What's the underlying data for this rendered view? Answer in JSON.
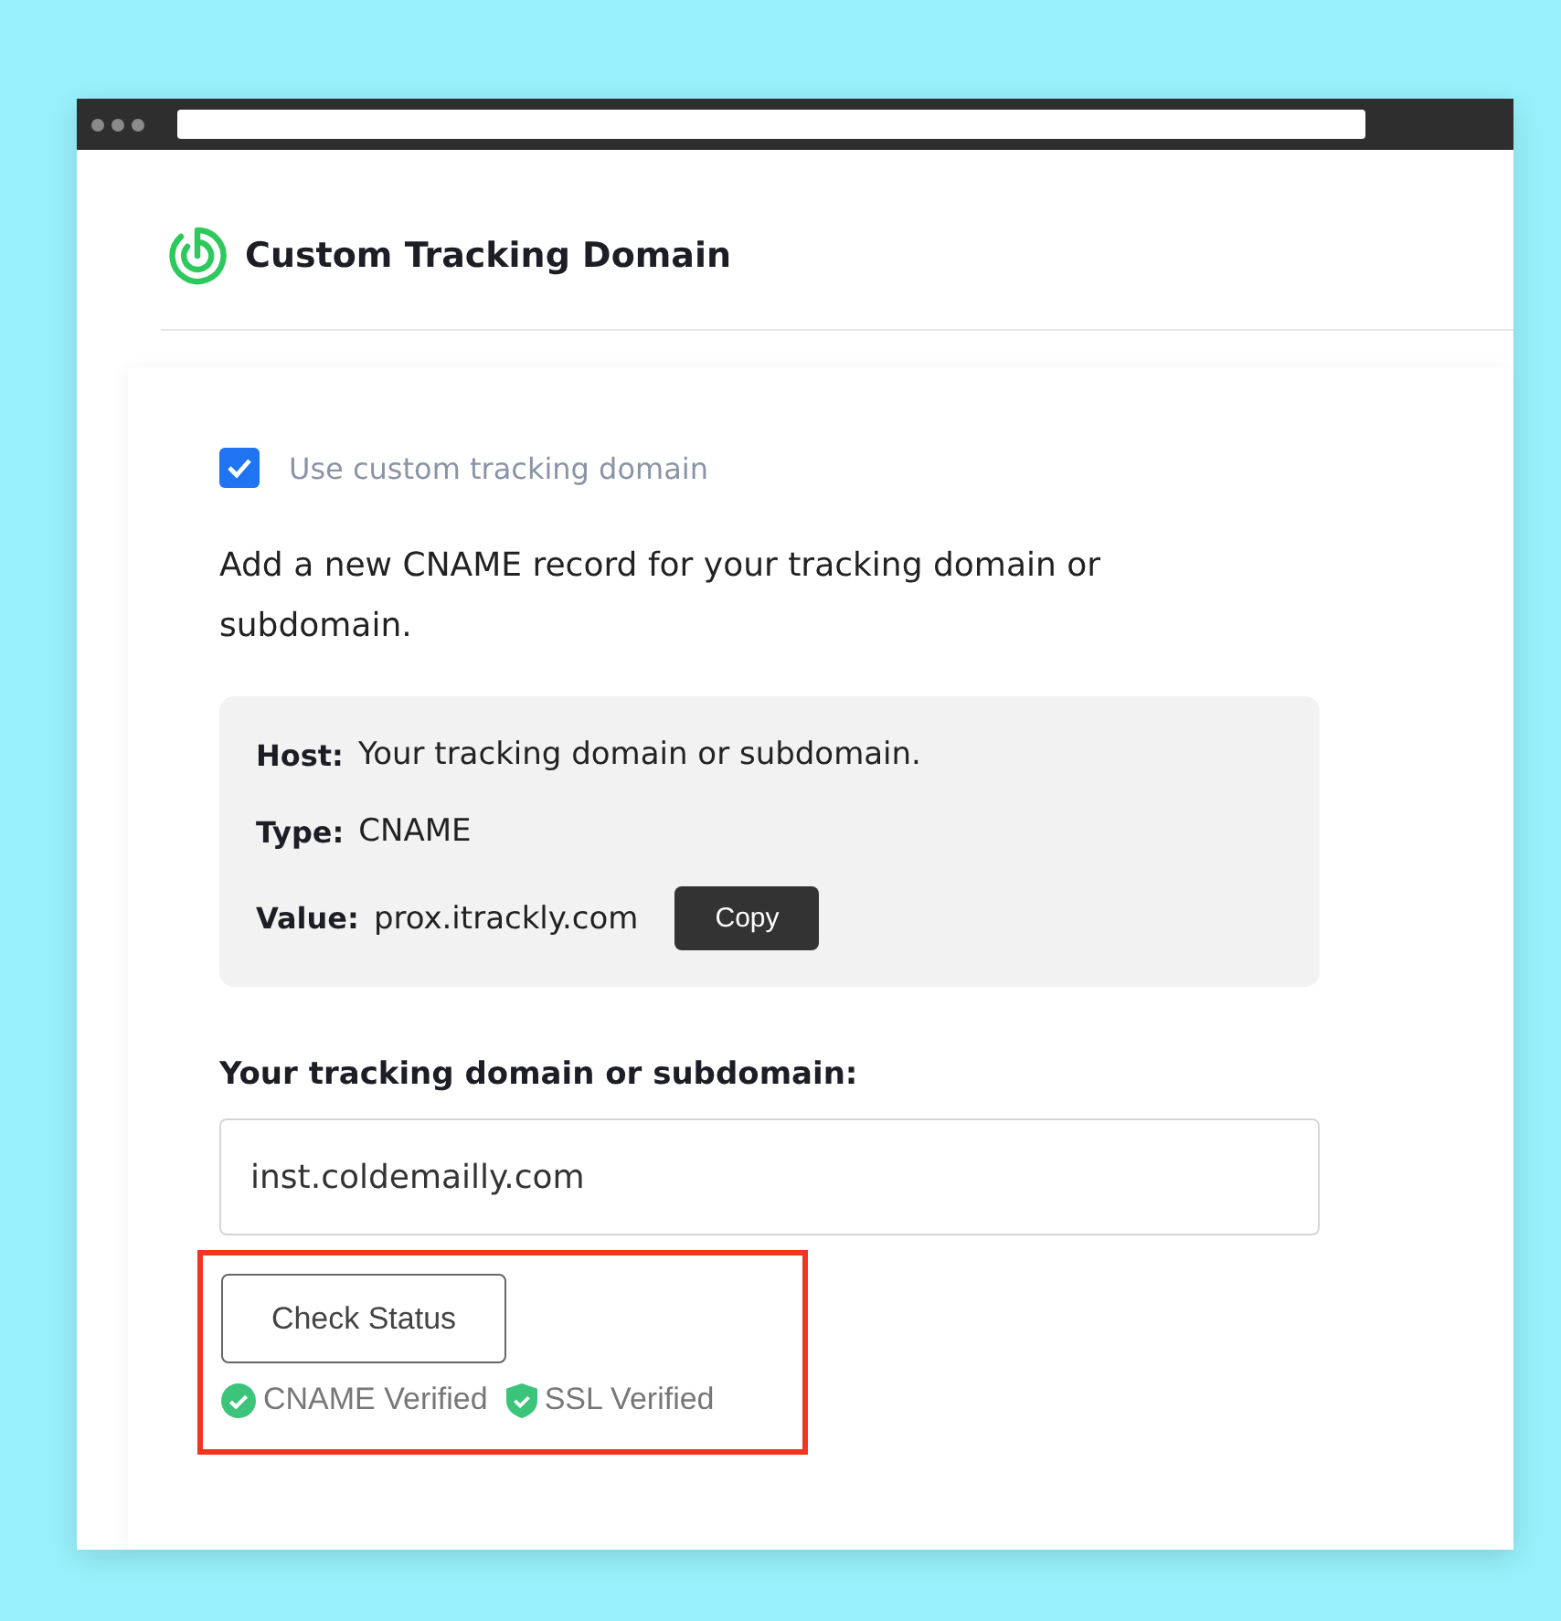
{
  "header": {
    "title": "Custom Tracking Domain"
  },
  "option": {
    "label": "Use custom tracking domain",
    "checked": true
  },
  "instructions": "Add a new CNAME record for your tracking domain or subdomain.",
  "record": [
    {
      "label": "Host:",
      "value": "Your tracking domain or subdomain."
    },
    {
      "label": "Type:",
      "value": "CNAME"
    },
    {
      "label": "Value:",
      "value": "prox.itrackly.com",
      "action": "Copy"
    }
  ],
  "domain_field": {
    "label": "Your tracking domain or subdomain:",
    "value": "inst.coldemailly.com"
  },
  "check_button": "Check Status",
  "statuses": [
    {
      "kind": "circle",
      "label": "CNAME Verified"
    },
    {
      "kind": "shield",
      "label": "SSL Verified"
    }
  ]
}
